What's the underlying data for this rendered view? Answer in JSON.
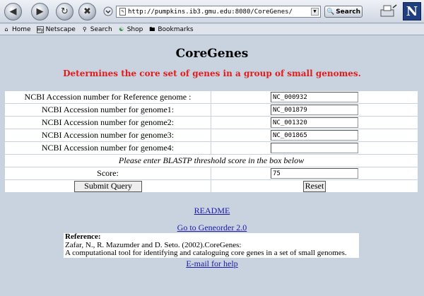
{
  "browser": {
    "url": "http://pumpkins.ib3.gmu.edu:8080/CoreGenes/",
    "search_label": "Search",
    "throbber_letter": "N",
    "bookmarks": [
      {
        "label": "Home",
        "icon": "home-icon"
      },
      {
        "label": "Netscape",
        "icon": "netscape-icon"
      },
      {
        "label": "Search",
        "icon": "search-icon"
      },
      {
        "label": "Shop",
        "icon": "shop-icon"
      },
      {
        "label": "Bookmarks",
        "icon": "bookmarks-folder-icon"
      }
    ]
  },
  "page": {
    "title": "CoreGenes",
    "subtitle": "Determines the core set of genes in a group of small genomes.",
    "subtitle_color": "#e21b1b",
    "form": {
      "rows": [
        {
          "label": "NCBI Accession number for Reference genome :",
          "value": "NC_000932"
        },
        {
          "label": "NCBI Accession number for genome1:",
          "value": "NC_001879"
        },
        {
          "label": "NCBI Accession number for genome2:",
          "value": "NC_001320"
        },
        {
          "label": "NCBI Accession number for genome3:",
          "value": "NC_001865"
        },
        {
          "label": "NCBI Accession number for genome4:",
          "value": ""
        }
      ],
      "note": "Please enter BLASTP threshold score in the box below",
      "score_label": "Score:",
      "score_value": "75",
      "submit_label": "Submit Query",
      "reset_label": "Reset"
    },
    "links": {
      "readme": "README",
      "geneorder": "Go to Geneorder 2.0",
      "email": "E-mail for help"
    },
    "reference": {
      "heading": "Reference:",
      "line1": "Zafar, N., R. Mazumder and D. Seto. (2002).CoreGenes:",
      "line2": "A computational tool for identifying and cataloguing core genes in a set of small genomes."
    }
  }
}
